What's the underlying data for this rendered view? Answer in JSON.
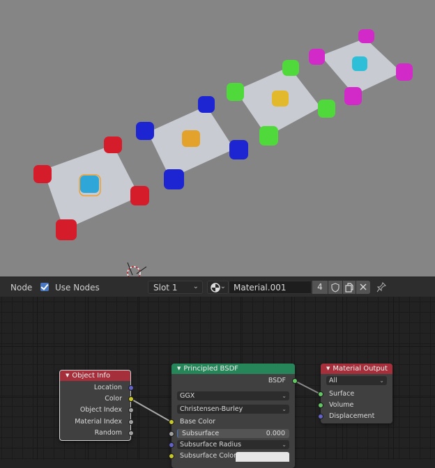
{
  "viewport": {
    "background": "#858585",
    "groups": [
      {
        "name": "group-red",
        "corner_color": "#d41c2a",
        "center_color": "#2ea6d8",
        "center_selected": true
      },
      {
        "name": "group-blue",
        "corner_color": "#1d24d2",
        "center_color": "#e3a22c",
        "center_selected": false
      },
      {
        "name": "group-green",
        "corner_color": "#4fd93a",
        "center_color": "#e3b92c",
        "center_selected": false
      },
      {
        "name": "group-magenta",
        "corner_color": "#d22ac8",
        "center_color": "#2ebfd8",
        "center_selected": false
      }
    ],
    "selection_outline_color": "#f0a030"
  },
  "header": {
    "editor_label": "Node",
    "use_nodes_label": "Use Nodes",
    "use_nodes_checked": true,
    "slot_value": "Slot 1",
    "material_name": "Material.001",
    "user_count": "4"
  },
  "nodes": {
    "object_info": {
      "title": "Object Info",
      "header_color": "#a5303b",
      "outputs": [
        "Location",
        "Color",
        "Object Index",
        "Material Index",
        "Random"
      ]
    },
    "principled": {
      "title": "Principled BSDF",
      "header_color": "#27855a",
      "output": "BSDF",
      "distribution": "GGX",
      "subsurface_method": "Christensen-Burley",
      "base_color_label": "Base Color",
      "subsurface_label": "Subsurface",
      "subsurface_value": "0.000",
      "subsurface_radius_label": "Subsurface Radius",
      "subsurface_color_label": "Subsurface Color"
    },
    "material_output": {
      "title": "Material Output",
      "header_color": "#a5303b",
      "target": "All",
      "inputs": [
        "Surface",
        "Volume",
        "Displacement"
      ]
    }
  }
}
